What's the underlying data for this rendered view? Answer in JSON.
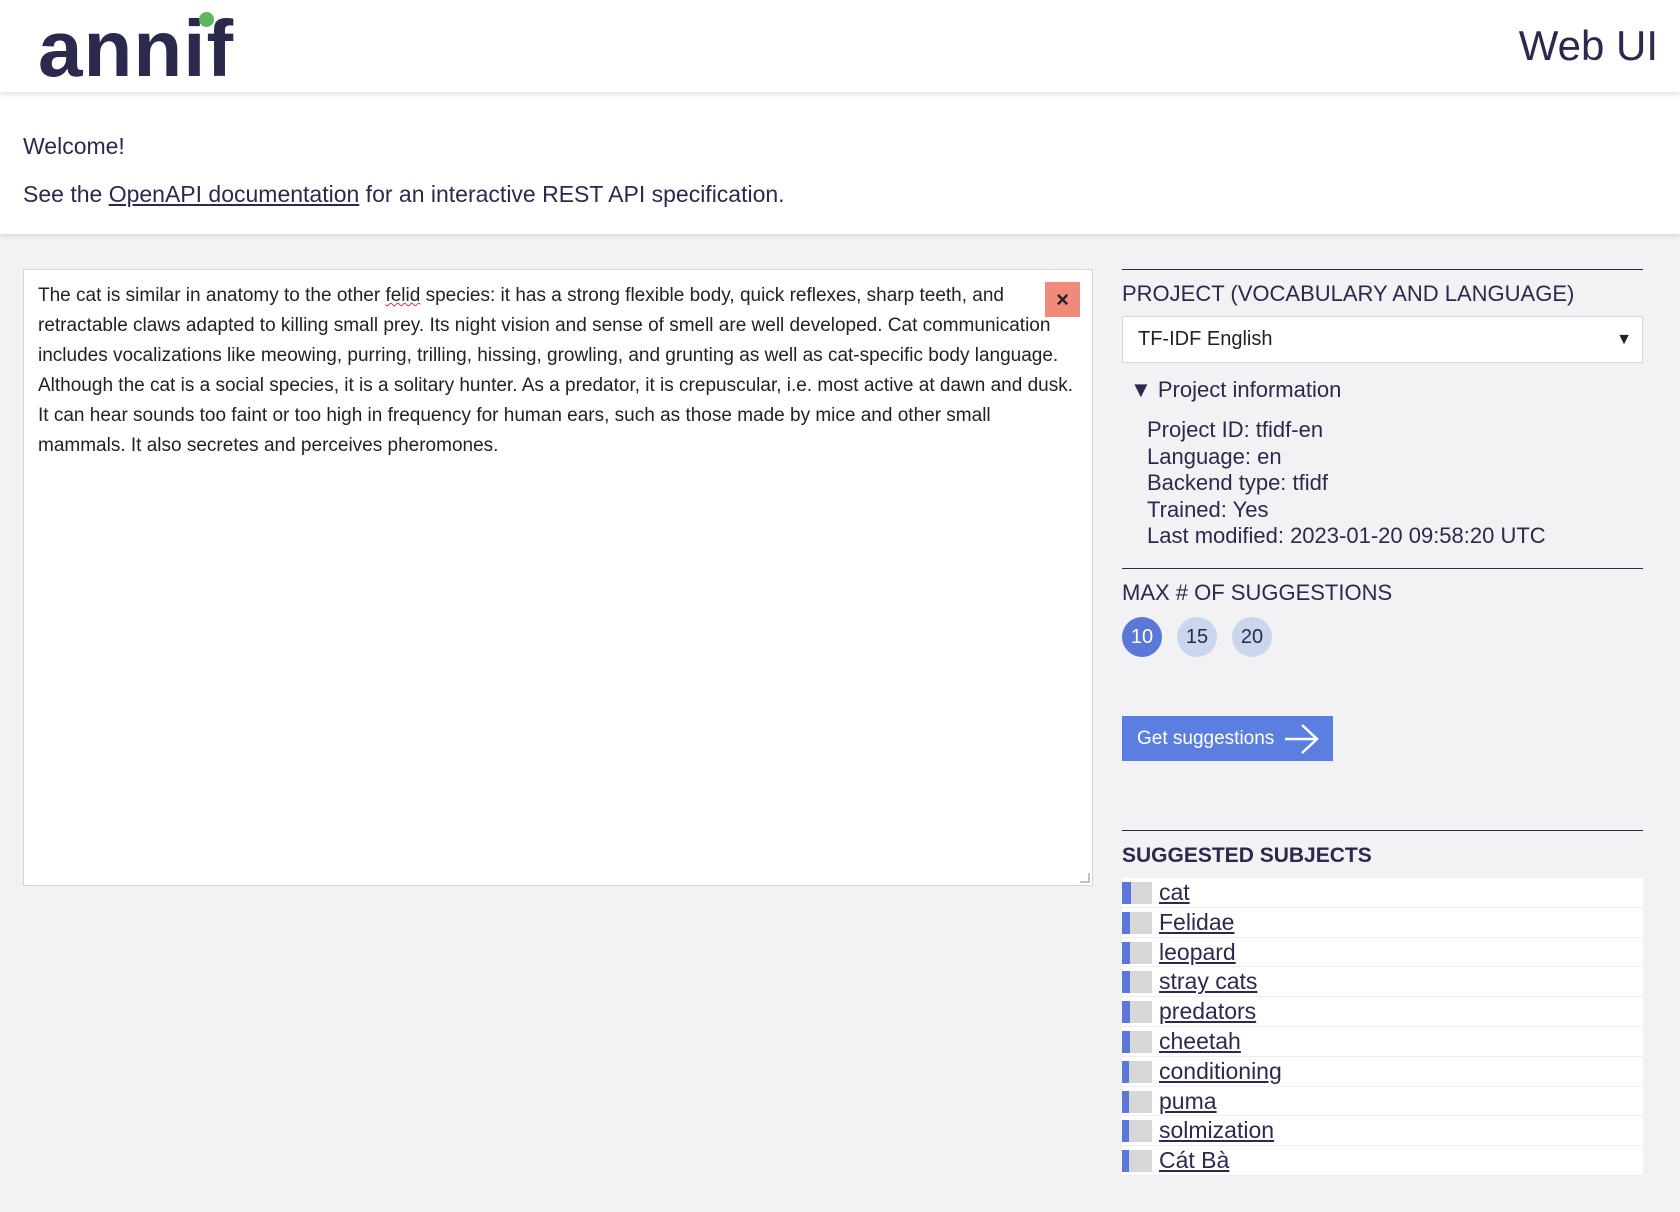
{
  "header": {
    "logo_text": "annif",
    "title": "Web UI"
  },
  "welcome": {
    "greeting": "Welcome!",
    "openapi_prefix": "See the ",
    "openapi_link": "OpenAPI documentation",
    "openapi_suffix": " for an interactive REST API specification."
  },
  "input": {
    "text": "The cat is similar in anatomy to the other felid species: it has a strong flexible body, quick reflexes, sharp teeth, and retractable claws adapted to killing small prey. Its night vision and sense of smell are well developed. Cat communication includes vocalizations like meowing, purring, trilling, hissing, growling, and grunting as well as cat-specific body language. Although the cat is a social species, it is a solitary hunter. As a predator, it is crepuscular, i.e. most active at dawn and dusk. It can hear sounds too faint or too high in frequency for human ears, such as those made by mice and other small mammals. It also secretes and perceives pheromones.",
    "text_before": "The cat is similar in anatomy to the other ",
    "misspelled": "felid",
    "text_after": " species: it has a strong flexible body, quick reflexes, sharp teeth, and retractable claws adapted to killing small prey. Its night vision and sense of smell are well developed. Cat communication includes vocalizations like meowing, purring, trilling, hissing, growling, and grunting as well as cat-specific body language. Although the cat is a social species, it is a solitary hunter. As a predator, it is crepuscular, i.e. most active at dawn and dusk. It can hear sounds too faint or too high in frequency for human ears, such as those made by mice and other small mammals. It also secretes and perceives pheromones.",
    "clear_label": "×"
  },
  "project": {
    "heading": "PROJECT (VOCABULARY AND LANGUAGE)",
    "selected": "TF-IDF English",
    "dropdown_arrow": "▼",
    "info_toggle": "▼ Project information",
    "info": {
      "project_id": "Project ID: tfidf-en",
      "language": "Language: en",
      "backend_type": "Backend type: tfidf",
      "trained": "Trained: Yes",
      "last_modified": "Last modified: 2023-01-20 09:58:20 UTC"
    }
  },
  "max_suggestions": {
    "heading": "MAX # OF SUGGESTIONS",
    "options": [
      "10",
      "15",
      "20"
    ],
    "selected": "10"
  },
  "action": {
    "get_suggestions_label": "Get suggestions"
  },
  "results": {
    "heading": "SUGGESTED SUBJECTS",
    "subjects": [
      {
        "label": "cat",
        "score": 0.3
      },
      {
        "label": "Felidae",
        "score": 0.28
      },
      {
        "label": "leopard",
        "score": 0.27
      },
      {
        "label": "stray cats",
        "score": 0.27
      },
      {
        "label": "predators",
        "score": 0.26
      },
      {
        "label": "cheetah",
        "score": 0.25
      },
      {
        "label": "conditioning",
        "score": 0.24
      },
      {
        "label": "puma",
        "score": 0.23
      },
      {
        "label": "solmization",
        "score": 0.23
      },
      {
        "label": "Cát Bà",
        "score": 0.22
      }
    ]
  },
  "colors": {
    "text": "#2b2a4c",
    "accent": "#5b78d8",
    "button": "#5b7fe0",
    "logo_dot": "#5cb85c",
    "clear_button": "#f08a7a"
  }
}
